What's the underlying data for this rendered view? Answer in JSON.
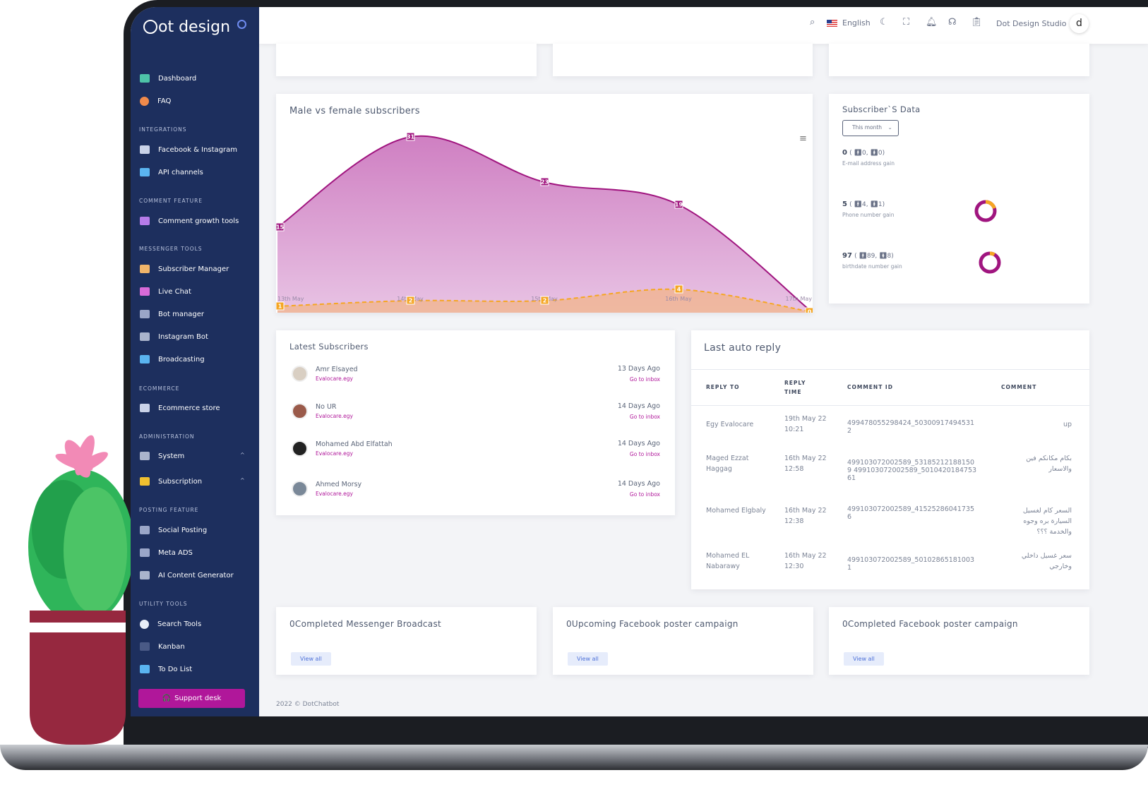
{
  "brand": {
    "logo_text": "ot design",
    "logo_letter": "d"
  },
  "header": {
    "language": "English",
    "user": "Dot Design Studio",
    "icons": [
      "search-icon",
      "us-flag-icon",
      "moon-icon",
      "fullscreen-icon",
      "bell-icon",
      "headset-icon",
      "clipboard-check-icon"
    ]
  },
  "sidebar": {
    "items": [
      {
        "label": "Dashboard",
        "icon": "monitor-icon",
        "color": "#4ec3a8"
      },
      {
        "label": "FAQ",
        "icon": "question-icon",
        "color": "#f08a4b"
      },
      {
        "section": "INTEGRATIONS"
      },
      {
        "label": "Facebook & Instagram",
        "icon": "flask-icon",
        "color": "#c9d2e8"
      },
      {
        "label": "API channels",
        "icon": "satellite-icon",
        "color": "#5ab4f0"
      },
      {
        "section": "COMMENT FEATURE"
      },
      {
        "label": "Comment growth tools",
        "icon": "comment-icon",
        "color": "#b57be8"
      },
      {
        "section": "MESSENGER TOOLS"
      },
      {
        "label": "Subscriber Manager",
        "icon": "user-icon",
        "color": "#f0b46a"
      },
      {
        "label": "Live Chat",
        "icon": "chat-icon",
        "color": "#d86ad8"
      },
      {
        "label": "Bot manager",
        "icon": "sitemap-icon",
        "color": "#9aa6c8"
      },
      {
        "label": "Instagram Bot",
        "icon": "gears-icon",
        "color": "#aab4cc"
      },
      {
        "label": "Broadcasting",
        "icon": "paper-plane-icon",
        "color": "#5ab4f0"
      },
      {
        "section": "ECOMMERCE"
      },
      {
        "label": "Ecommerce store",
        "icon": "cart-icon",
        "color": "#c9d2e8"
      },
      {
        "section": "ADMINISTRATION"
      },
      {
        "label": "System",
        "icon": "gears-icon",
        "color": "#aab4cc",
        "caret": "^"
      },
      {
        "label": "Subscription",
        "icon": "users-icon",
        "color": "#f0c030",
        "caret": "^"
      },
      {
        "section": "POSTING FEATURE"
      },
      {
        "label": "Social Posting",
        "icon": "share-icon",
        "color": "#9aa6c8"
      },
      {
        "label": "Meta ADS",
        "icon": "phone-icon",
        "color": "#9aa6c8"
      },
      {
        "label": "AI Content Generator",
        "icon": "gears-icon",
        "color": "#aab4cc"
      },
      {
        "section": "UTILITY TOOLS"
      },
      {
        "label": "Search Tools",
        "icon": "search-icon",
        "color": "#e8eef8"
      },
      {
        "label": "Kanban",
        "icon": "link-icon",
        "color": "#4a5a86"
      },
      {
        "label": "To Do List",
        "icon": "pen-icon",
        "color": "#5ab4f0"
      }
    ],
    "support": "Support desk"
  },
  "chart_card": {
    "title": "Male vs female subscribers"
  },
  "chart_data": {
    "type": "area",
    "title": "Male vs female subscribers",
    "categories": [
      "13th May",
      "14th May",
      "15th May",
      "16th May",
      "17th May"
    ],
    "series": [
      {
        "values": [
          15,
          31,
          23,
          19,
          0
        ],
        "color": "#a0157f"
      },
      {
        "values": [
          1,
          2,
          2,
          4,
          0
        ],
        "color": "#f5a623"
      }
    ],
    "grid": false
  },
  "subs_data": {
    "title": "Subscriber`S Data",
    "filter": "This month",
    "rows": [
      {
        "total": "0",
        "male": "0",
        "female": "0",
        "label": "E-mail address gain",
        "m": 0,
        "f": 0
      },
      {
        "total": "5",
        "male": "4",
        "female": "1",
        "label": "Phone number gain",
        "m": 4,
        "f": 1
      },
      {
        "total": "97",
        "male": "89",
        "female": "8",
        "label": "birthdate number gain",
        "m": 89,
        "f": 8
      }
    ]
  },
  "latest": {
    "title": "Latest Subscribers",
    "items": [
      {
        "name": "Amr Elsayed",
        "page": "Evalocare.egy",
        "ago": "13 Days Ago",
        "link": "Go to inbox"
      },
      {
        "name": "No UR",
        "page": "Evalocare.egy",
        "ago": "14 Days Ago",
        "link": "Go to inbox"
      },
      {
        "name": "Mohamed Abd Elfattah",
        "page": "Evalocare.egy",
        "ago": "14 Days Ago",
        "link": "Go to inbox"
      },
      {
        "name": "Ahmed Morsy",
        "page": "Evalocare.egy",
        "ago": "14 Days Ago",
        "link": "Go to inbox"
      }
    ]
  },
  "auto_reply": {
    "title": "Last auto reply",
    "headers": [
      "REPLY TO",
      "REPLY TIME",
      "COMMENT ID",
      "COMMENT"
    ],
    "rows": [
      {
        "to": "Egy Evalocare",
        "time": "19th May 22 10:21",
        "id": "499478055298424_503009174945312",
        "comment": "up"
      },
      {
        "to": "Maged Ezzat Haggag",
        "time": "16th May 22 12:58",
        "id": "499103072002589_531852121881509 499103072002589_501042018475361",
        "comment": "بكام مكانكم فين والاسعار"
      },
      {
        "to": "Mohamed Elgbaly",
        "time": "16th May 22 12:38",
        "id": "499103072002589_415252860417356",
        "comment": "السعر كام لغسيل السيارة بره وجوه والخدمة ؟؟؟"
      },
      {
        "to": "Mohamed EL Nabarawy",
        "time": "16th May 22 12:30",
        "id": "499103072002589_501028651810031",
        "comment": "سعر غسيل داخلي وخارجي"
      }
    ]
  },
  "bottom_cards": [
    {
      "title": "0Completed Messenger Broadcast",
      "button": "View all"
    },
    {
      "title": "0Upcoming Facebook poster campaign",
      "button": "View all"
    },
    {
      "title": "0Completed Facebook poster campaign",
      "button": "View all"
    }
  ],
  "footer": "2022 © DotChatbot"
}
